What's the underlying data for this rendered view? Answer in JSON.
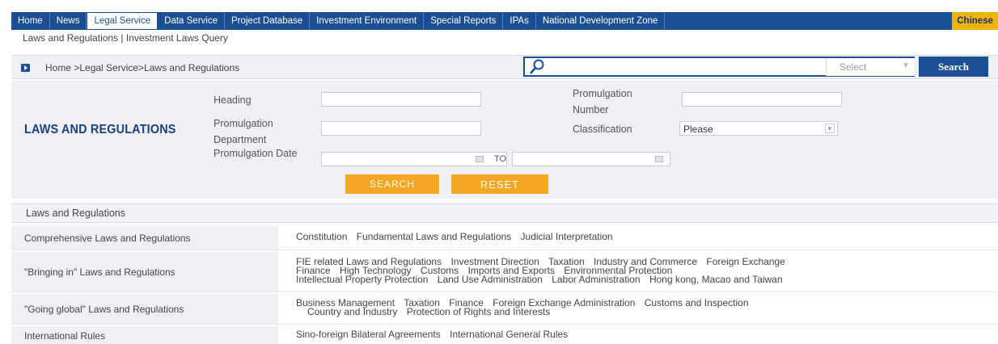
{
  "nav": {
    "items": [
      "Home",
      "News",
      "Legal Service",
      "Data Service",
      "Project Database",
      "Investment Environment",
      "Special Reports",
      "IPAs",
      "National Development Zone"
    ],
    "active": "Legal Service",
    "language": "Chinese"
  },
  "subnav": "Laws and Regulations | Investment Laws Query",
  "breadcrumb": "Home >Legal Service>Laws and Regulations",
  "search": {
    "select_label": "Select",
    "button": "Search"
  },
  "form": {
    "title": "LAWS AND REGULATIONS",
    "heading_label": "Heading",
    "promulgation_number_label": "Promulgation Number",
    "promulgation_department_label": "Promulgation Department",
    "classification_label": "Classification",
    "classification_value": "Please",
    "promulgation_date_label": "Promulgation Date",
    "to_label": "TO",
    "search_button": "SEARCH",
    "reset_button": "RESET"
  },
  "laws": {
    "section_title": "Laws and Regulations",
    "rows": [
      {
        "category": "Comprehensive Laws and Regulations",
        "lines": [
          [
            "Constitution",
            "Fundamental Laws and Regulations",
            "Judicial Interpretation"
          ]
        ]
      },
      {
        "category": "\"Bringing in\" Laws and Regulations",
        "lines": [
          [
            "FIE related Laws and Regulations",
            "Investment Direction",
            "Taxation",
            "Industry and Commerce",
            "Foreign Exchange"
          ],
          [
            "Finance",
            "High Technology",
            "Customs",
            "Imports and Exports",
            "Environmental Protection"
          ],
          [
            "Intellectual Property Protection",
            "Land Use Administration",
            "Labor Administration",
            "Hong kong, Macao and Taiwan"
          ]
        ]
      },
      {
        "category": "\"Going global\" Laws and Regulations",
        "lines": [
          [
            "Business Management",
            "Taxation",
            "Finance",
            "Foreign Exchange Administration",
            "Customs and Inspection"
          ],
          [
            "Country and Industry",
            "Protection of Rights and Interests"
          ]
        ]
      },
      {
        "category": "International Rules",
        "lines": [
          [
            "Sino-foreign Bilateral Agreements",
            "International General Rules"
          ]
        ]
      }
    ]
  }
}
